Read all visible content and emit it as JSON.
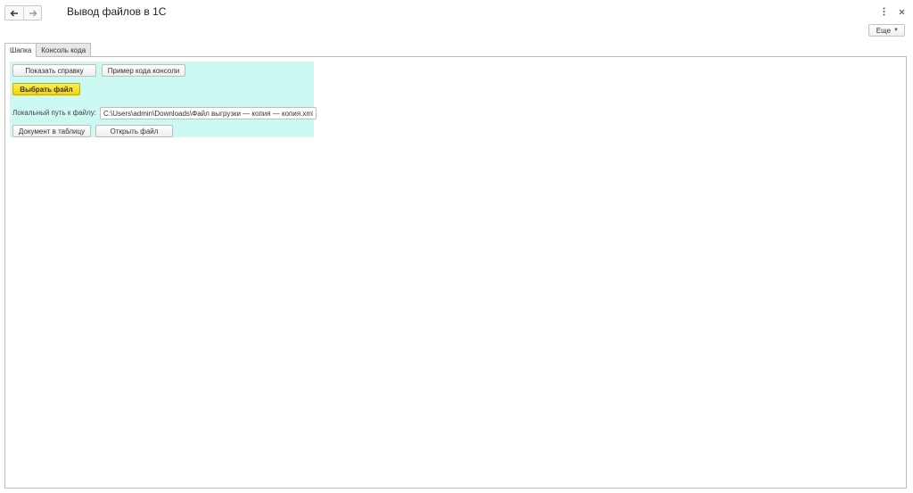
{
  "window": {
    "title": "Вывод файлов в 1С",
    "more_label": "Еще",
    "icons": {
      "back": "arrow-left-icon",
      "forward": "arrow-right-icon",
      "menu": "more-vertical-icon",
      "close": "close-icon"
    }
  },
  "tabs": [
    {
      "label": "Шапка",
      "active": true
    },
    {
      "label": "Консоль кода",
      "active": false
    }
  ],
  "form": {
    "show_help_label": "Показать справку",
    "console_example_label": "Пример кода консоли",
    "choose_file_label": "Выбрать файл",
    "local_path_label": "Локальный путь к файлу:",
    "local_path_value": "C:\\Users\\admin\\Downloads\\Файл выгрузки — копия — копия.xml",
    "doc_to_table_label": "Документ в таблицу",
    "open_file_label": "Открыть файл"
  },
  "colors": {
    "group_background": "#ccfaf2",
    "primary_button": "#f4d400"
  }
}
